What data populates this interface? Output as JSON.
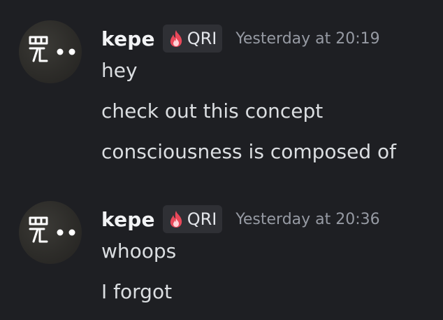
{
  "messages": [
    {
      "author": "kepe",
      "tag": "QRI",
      "timestamp": "Yesterday at 20:19",
      "lines": [
        "hey",
        "check out this concept",
        "consciousness is composed of"
      ]
    },
    {
      "author": "kepe",
      "tag": "QRI",
      "timestamp": "Yesterday at 20:36",
      "lines": [
        "whoops",
        "I forgot"
      ]
    }
  ],
  "icons": {
    "avatar": "avatar-glyph-icon",
    "tag": "fire-icon"
  },
  "colors": {
    "background": "#1e1f23",
    "username": "#f2f3f5",
    "timestamp": "#969aa3",
    "message_text": "#dbdee1",
    "tag_background": "#2f3035",
    "fire_icon": "#e8485a"
  }
}
